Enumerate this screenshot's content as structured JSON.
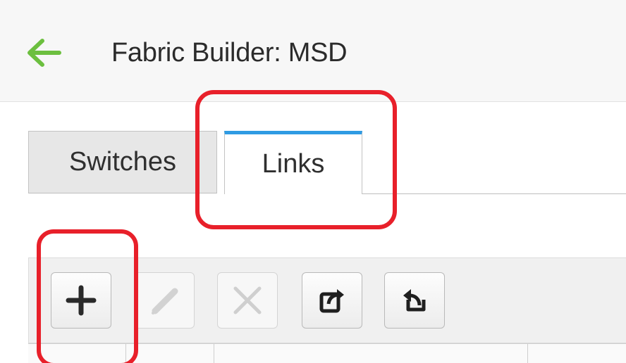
{
  "header": {
    "back_icon": "arrow-left-icon",
    "accent_color": "#6cbf3f",
    "title": "Fabric Builder: MSD"
  },
  "tabs": [
    {
      "label": "Switches",
      "active": false
    },
    {
      "label": "Links",
      "active": true,
      "indicator_color": "#2f9be3"
    }
  ],
  "toolbar": {
    "buttons": [
      {
        "name": "add",
        "icon": "plus-icon",
        "enabled": true
      },
      {
        "name": "edit",
        "icon": "pencil-icon",
        "enabled": false
      },
      {
        "name": "delete",
        "icon": "x-icon",
        "enabled": false
      },
      {
        "name": "export",
        "icon": "export-icon",
        "enabled": true
      },
      {
        "name": "import",
        "icon": "import-icon",
        "enabled": true
      }
    ]
  },
  "annotations": {
    "highlight_color": "#e8202a"
  }
}
